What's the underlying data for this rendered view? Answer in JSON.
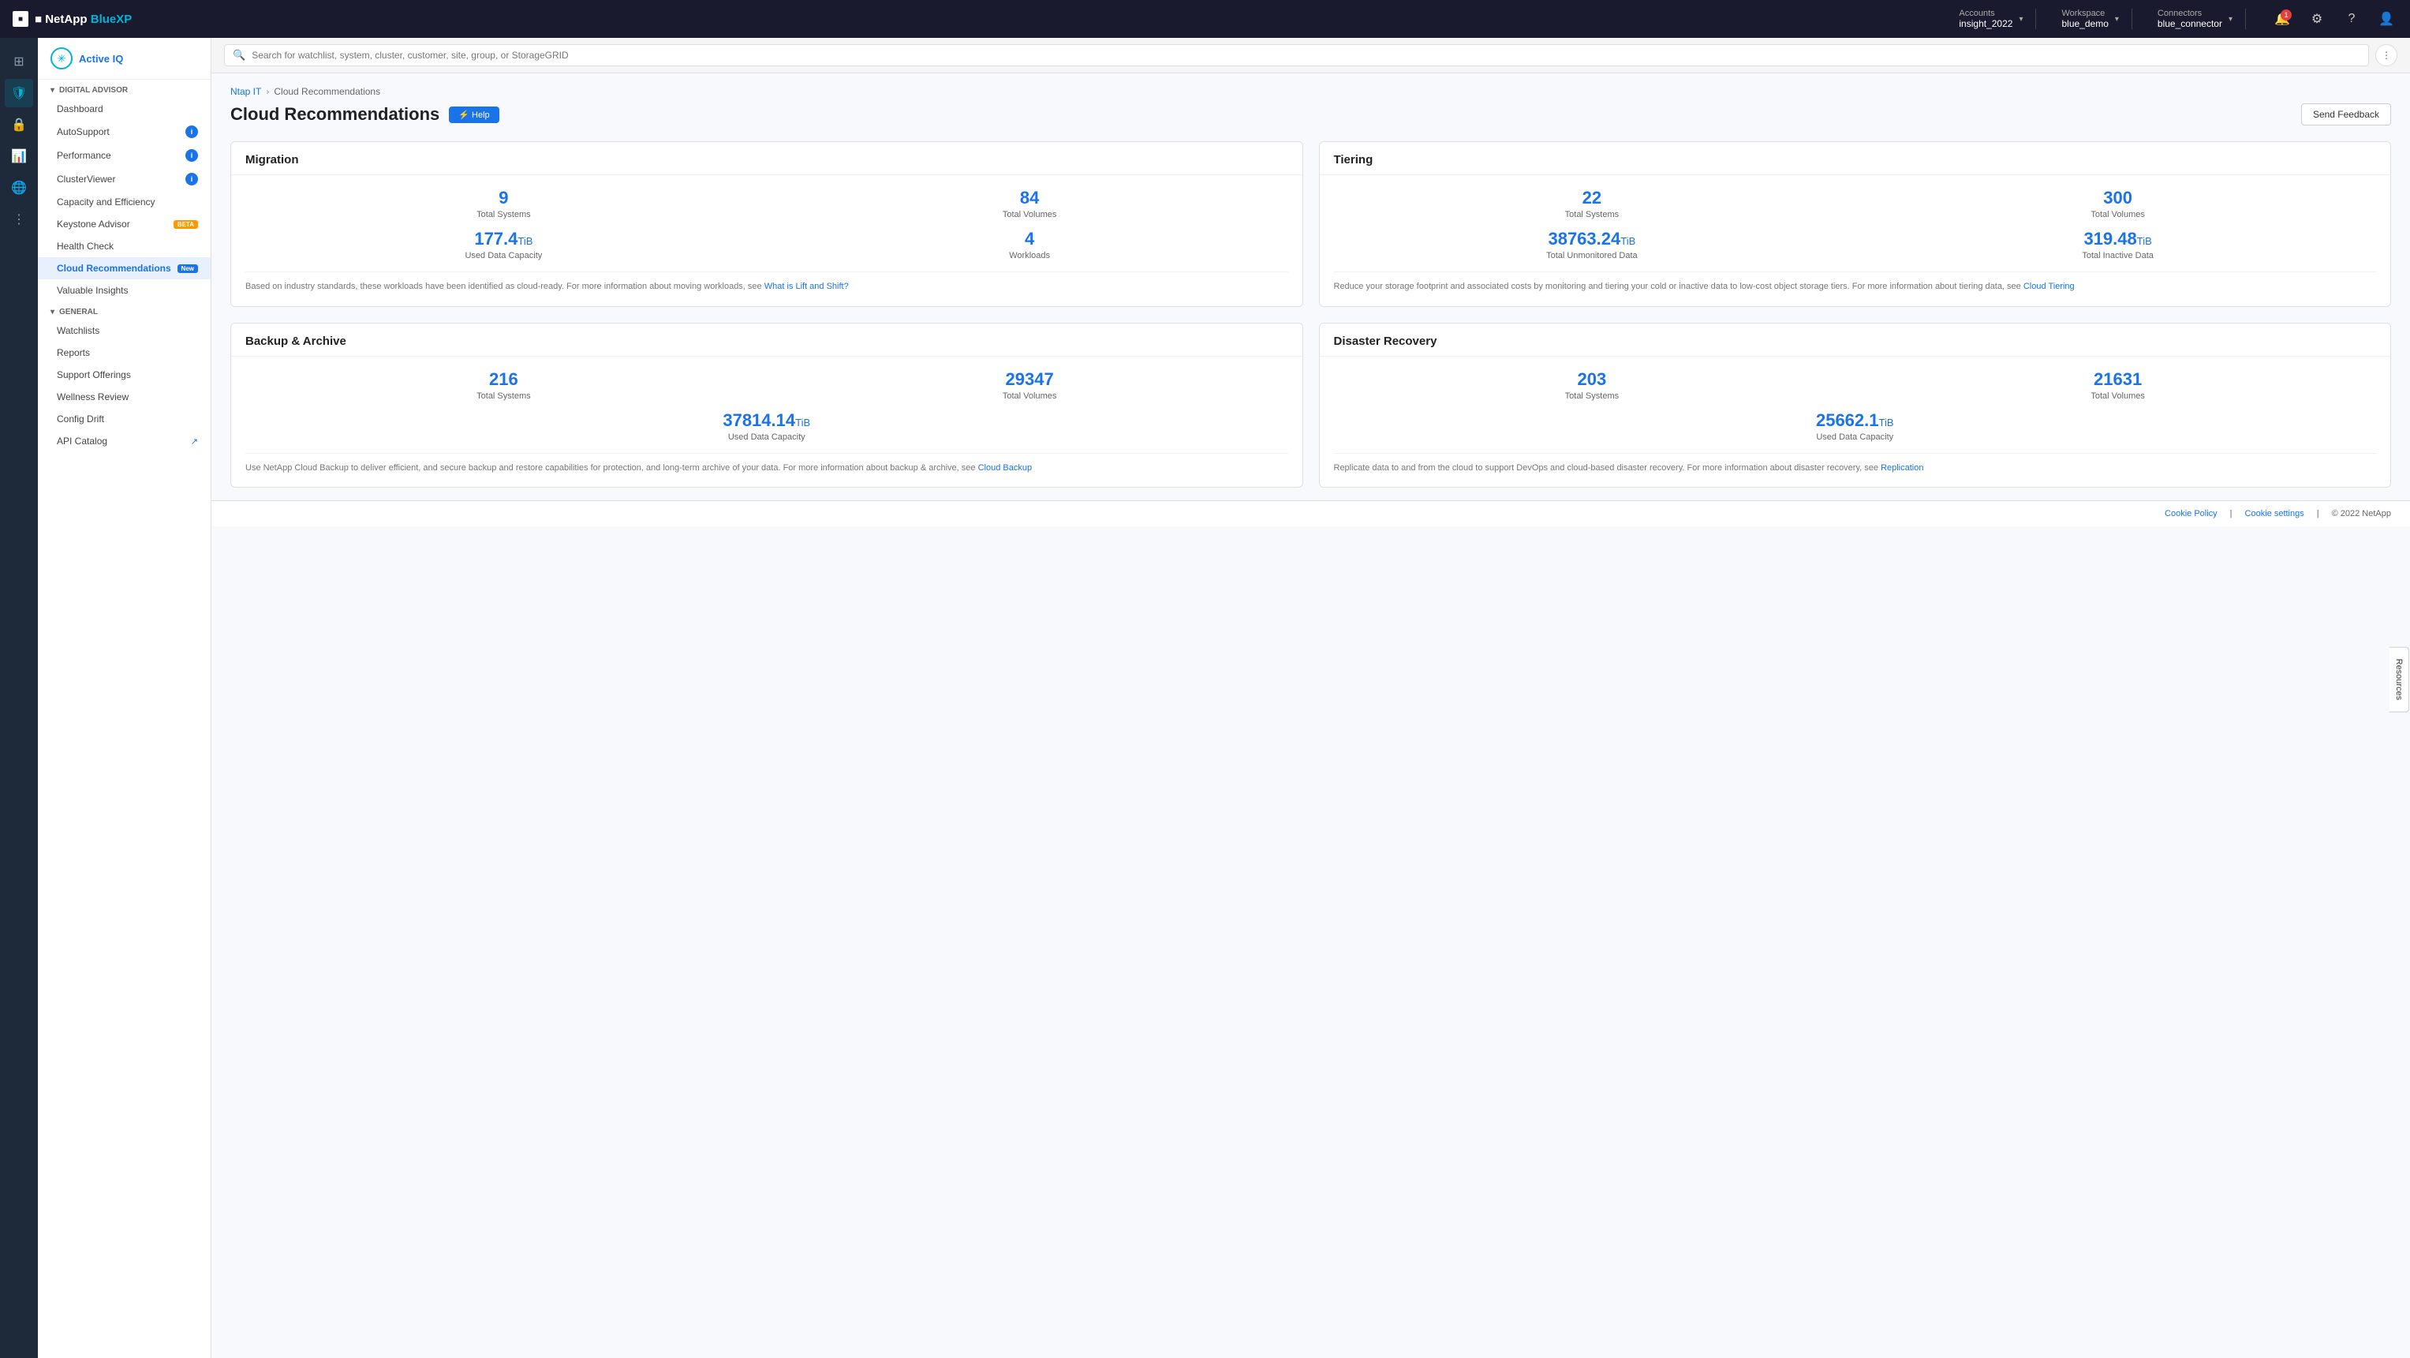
{
  "topnav": {
    "logo_text": "■ NetApp",
    "bluexp_text": " BlueXP",
    "accounts_label": "Accounts",
    "accounts_value": "insight_2022",
    "workspace_label": "Workspace",
    "workspace_value": "blue_demo",
    "connectors_label": "Connectors",
    "connectors_value": "blue_connector",
    "notification_count": "1"
  },
  "sidebar": {
    "logo_label": "Active IQ",
    "digital_advisor_label": "DIGITAL ADVISOR",
    "items": [
      {
        "id": "dashboard",
        "label": "Dashboard",
        "badge": null,
        "active": false
      },
      {
        "id": "autosupport",
        "label": "AutoSupport",
        "badge": "info",
        "active": false
      },
      {
        "id": "performance",
        "label": "Performance",
        "badge": "info",
        "active": false
      },
      {
        "id": "clusterviewer",
        "label": "ClusterViewer",
        "badge": "info",
        "active": false
      },
      {
        "id": "capacity",
        "label": "Capacity and Efficiency",
        "badge": null,
        "active": false
      },
      {
        "id": "keystone",
        "label": "Keystone Advisor",
        "badge": "beta",
        "active": false
      },
      {
        "id": "healthcheck",
        "label": "Health Check",
        "badge": null,
        "active": false
      },
      {
        "id": "cloudrecommendations",
        "label": "Cloud Recommendations",
        "badge": "new",
        "active": true
      },
      {
        "id": "valuableinsights",
        "label": "Valuable Insights",
        "badge": null,
        "active": false
      }
    ],
    "general_label": "GENERAL",
    "general_items": [
      {
        "id": "watchlists",
        "label": "Watchlists"
      },
      {
        "id": "reports",
        "label": "Reports"
      },
      {
        "id": "support",
        "label": "Support Offerings"
      },
      {
        "id": "wellness",
        "label": "Wellness Review"
      },
      {
        "id": "configdrift",
        "label": "Config Drift"
      },
      {
        "id": "apicatalog",
        "label": "API Catalog"
      }
    ]
  },
  "search": {
    "placeholder": "Search for watchlist, system, cluster, customer, site, group, or StorageGRID"
  },
  "breadcrumb": {
    "parent": "Ntap IT",
    "current": "Cloud Recommendations"
  },
  "page": {
    "title": "Cloud Recommendations",
    "help_label": "⚡ Help",
    "send_feedback_label": "Send Feedback"
  },
  "migration": {
    "title": "Migration",
    "total_systems_value": "9",
    "total_systems_label": "Total Systems",
    "total_volumes_value": "84",
    "total_volumes_label": "Total Volumes",
    "used_data_capacity_value": "177.4",
    "used_data_capacity_unit": "TiB",
    "used_data_capacity_label": "Used Data Capacity",
    "workloads_value": "4",
    "workloads_label": "Workloads",
    "description": "Based on industry standards, these workloads have been identified as cloud-ready. For more information about moving workloads, see ",
    "link_text": "What is Lift and Shift?",
    "link_url": "#"
  },
  "tiering": {
    "title": "Tiering",
    "total_systems_value": "22",
    "total_systems_label": "Total Systems",
    "total_volumes_value": "300",
    "total_volumes_label": "Total Volumes",
    "unmonitored_value": "38763.24",
    "unmonitored_unit": "TiB",
    "unmonitored_label": "Total Unmonitored Data",
    "inactive_value": "319.48",
    "inactive_unit": "TiB",
    "inactive_label": "Total Inactive Data",
    "description": "Reduce your storage footprint and associated costs by monitoring and tiering your cold or inactive data to low-cost object storage tiers. For more information about tiering data, see ",
    "link_text": "Cloud Tiering",
    "link_url": "#"
  },
  "backup": {
    "title": "Backup & Archive",
    "total_systems_value": "216",
    "total_systems_label": "Total Systems",
    "total_volumes_value": "29347",
    "total_volumes_label": "Total Volumes",
    "used_data_capacity_value": "37814.14",
    "used_data_capacity_unit": "TiB",
    "used_data_capacity_label": "Used Data Capacity",
    "description": "Use NetApp Cloud Backup to deliver efficient, and secure backup and restore capabilities for protection, and long-term archive of your data. For more information about backup & archive, see ",
    "link_text": "Cloud Backup",
    "link_url": "#"
  },
  "disaster": {
    "title": "Disaster Recovery",
    "total_systems_value": "203",
    "total_systems_label": "Total Systems",
    "total_volumes_value": "21631",
    "total_volumes_label": "Total Volumes",
    "used_data_capacity_value": "25662.1",
    "used_data_capacity_unit": "TiB",
    "used_data_capacity_label": "Used Data Capacity",
    "description": "Replicate data to and from the cloud to support DevOps and cloud-based disaster recovery. For more information about disaster recovery, see ",
    "link_text": "Replication",
    "link_url": "#"
  },
  "footer": {
    "cookie_policy": "Cookie Policy",
    "cookie_settings": "Cookie settings",
    "copyright": "© 2022 NetApp"
  },
  "resources_tab": "Resources"
}
